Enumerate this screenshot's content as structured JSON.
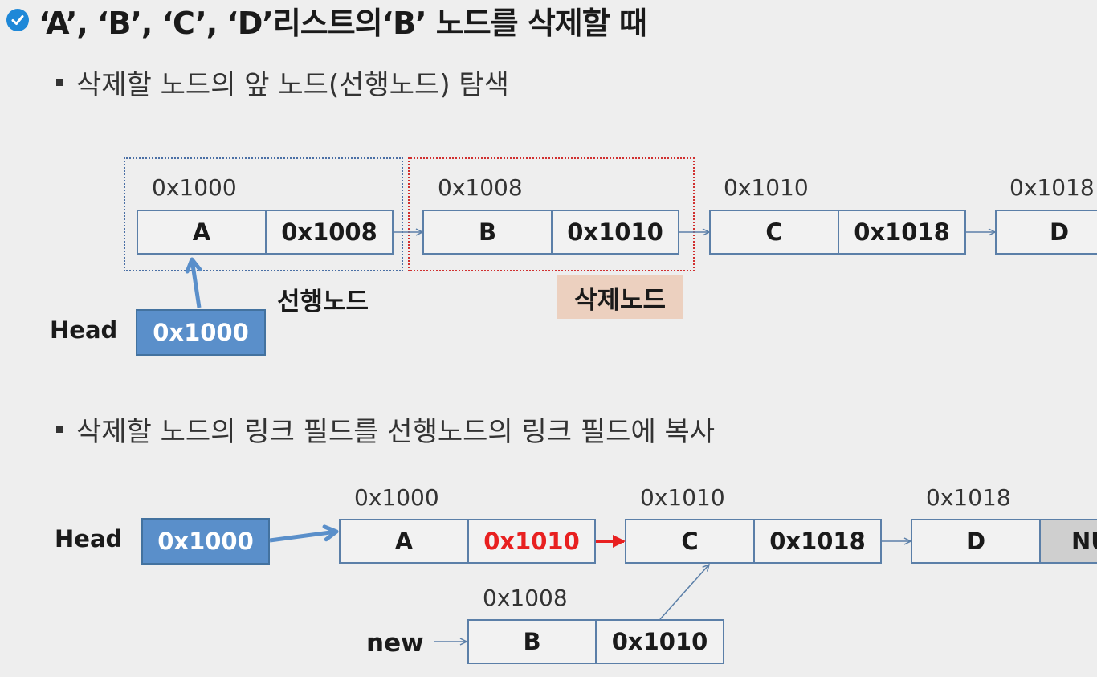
{
  "title": "‘A’, ‘B’, ‘C’, ‘D’리스트의‘B’ 노드를 삭제할 때",
  "step1": {
    "text": "삭제할 노드의 앞 노드(선행노드) 탐색",
    "nodes": [
      {
        "addr": "0x1000",
        "data": "A",
        "link": "0x1008"
      },
      {
        "addr": "0x1008",
        "data": "B",
        "link": "0x1010"
      },
      {
        "addr": "0x1010",
        "data": "C",
        "link": "0x1018"
      },
      {
        "addr": "0x1018",
        "data": "D"
      }
    ],
    "head_label": "Head",
    "head_value": "0x1000",
    "prev_label": "선행노드",
    "del_label": "삭제노드"
  },
  "step2": {
    "text": "삭제할 노드의 링크 필드를 선행노드의 링크 필드에 복사",
    "head_label": "Head",
    "head_value": "0x1000",
    "nodes": [
      {
        "addr": "0x1000",
        "data": "A",
        "link": "0x1010"
      },
      {
        "addr": "0x1010",
        "data": "C",
        "link": "0x1018"
      },
      {
        "addr": "0x1018",
        "data": "D",
        "link": "NU"
      }
    ],
    "new_label": "new",
    "new_node": {
      "addr": "0x1008",
      "data": "B",
      "link": "0x1010"
    }
  },
  "colors": {
    "accent": "#5a8fca",
    "prev_outline": "#4a6fa5",
    "del_outline": "#d03030",
    "changed_link": "#e82020",
    "del_label_bg": "#ecd0bf",
    "check": "#1e88d8"
  },
  "icons": {
    "title_marker": "check-circle-icon",
    "bullet": "square-bullet-icon"
  }
}
